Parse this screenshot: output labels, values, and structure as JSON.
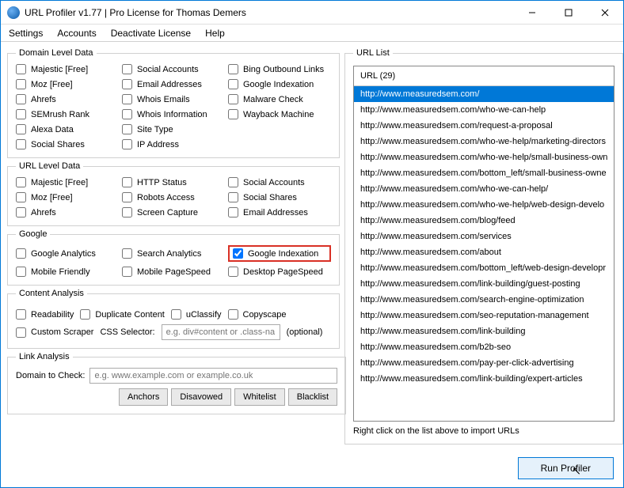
{
  "title": "URL Profiler v1.77 | Pro License for Thomas Demers",
  "menu": [
    "Settings",
    "Accounts",
    "Deactivate License",
    "Help"
  ],
  "groups": {
    "domain": {
      "legend": "Domain Level Data",
      "items": [
        {
          "label": "Majestic [Free]",
          "c": false
        },
        {
          "label": "Social Accounts",
          "c": false
        },
        {
          "label": "Bing Outbound Links",
          "c": false
        },
        {
          "label": "Moz [Free]",
          "c": false
        },
        {
          "label": "Email Addresses",
          "c": false
        },
        {
          "label": "Google Indexation",
          "c": false
        },
        {
          "label": "Ahrefs",
          "c": false
        },
        {
          "label": "Whois Emails",
          "c": false
        },
        {
          "label": "Malware Check",
          "c": false
        },
        {
          "label": "SEMrush Rank",
          "c": false
        },
        {
          "label": "Whois Information",
          "c": false
        },
        {
          "label": "Wayback Machine",
          "c": false
        },
        {
          "label": "Alexa Data",
          "c": false
        },
        {
          "label": "Site Type",
          "c": false
        },
        {
          "label": "",
          "c": false,
          "empty": true
        },
        {
          "label": "Social Shares",
          "c": false
        },
        {
          "label": "IP Address",
          "c": false
        }
      ]
    },
    "url": {
      "legend": "URL Level Data",
      "items": [
        {
          "label": "Majestic [Free]",
          "c": false
        },
        {
          "label": "HTTP Status",
          "c": false
        },
        {
          "label": "Social Accounts",
          "c": false
        },
        {
          "label": "Moz [Free]",
          "c": false
        },
        {
          "label": "Robots Access",
          "c": false
        },
        {
          "label": "Social Shares",
          "c": false
        },
        {
          "label": "Ahrefs",
          "c": false
        },
        {
          "label": "Screen Capture",
          "c": false
        },
        {
          "label": "Email Addresses",
          "c": false
        }
      ]
    },
    "google": {
      "legend": "Google",
      "items": [
        {
          "label": "Google Analytics",
          "c": false
        },
        {
          "label": "Search Analytics",
          "c": false
        },
        {
          "label": "Google Indexation",
          "c": true,
          "hl": true
        },
        {
          "label": "Mobile Friendly",
          "c": false
        },
        {
          "label": "Mobile PageSpeed",
          "c": false
        },
        {
          "label": "Desktop PageSpeed",
          "c": false
        }
      ]
    },
    "content": {
      "legend": "Content Analysis",
      "row1": [
        {
          "label": "Readability",
          "c": false
        },
        {
          "label": "Duplicate Content",
          "c": false
        },
        {
          "label": "uClassify",
          "c": false
        },
        {
          "label": "Copyscape",
          "c": false
        }
      ],
      "scraper_label": "Custom Scraper",
      "css_label": "CSS Selector:",
      "css_placeholder": "e.g. div#content or .class-na",
      "optional": "(optional)"
    },
    "link": {
      "legend": "Link Analysis",
      "domain_label": "Domain to Check:",
      "domain_placeholder": "e.g. www.example.com or example.co.uk",
      "buttons": [
        "Anchors",
        "Disavowed",
        "Whitelist",
        "Blacklist"
      ]
    }
  },
  "urllist": {
    "legend": "URL List",
    "header": "URL (29)",
    "items": [
      "http://www.measuredsem.com/",
      "http://www.measuredsem.com/who-we-can-help",
      "http://www.measuredsem.com/request-a-proposal",
      "http://www.measuredsem.com/who-we-help/marketing-directors",
      "http://www.measuredsem.com/who-we-help/small-business-own",
      "http://www.measuredsem.com/bottom_left/small-business-owne",
      "http://www.measuredsem.com/who-we-can-help/",
      "http://www.measuredsem.com/who-we-help/web-design-develo",
      "http://www.measuredsem.com/blog/feed",
      "http://www.measuredsem.com/services",
      "http://www.measuredsem.com/about",
      "http://www.measuredsem.com/bottom_left/web-design-developr",
      "http://www.measuredsem.com/link-building/guest-posting",
      "http://www.measuredsem.com/search-engine-optimization",
      "http://www.measuredsem.com/seo-reputation-management",
      "http://www.measuredsem.com/link-building",
      "http://www.measuredsem.com/b2b-seo",
      "http://www.measuredsem.com/pay-per-click-advertising",
      "http://www.measuredsem.com/link-building/expert-articles"
    ],
    "selected": 0,
    "hint": "Right click on the list above to import URLs"
  },
  "run_label": "Run Profiler"
}
